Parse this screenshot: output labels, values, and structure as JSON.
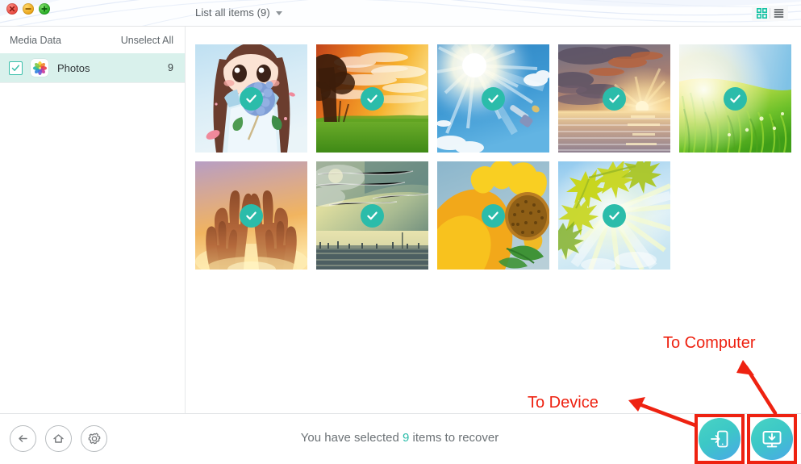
{
  "window": {
    "traffic_lights": [
      {
        "name": "close",
        "color": "#e8453c",
        "glyph": "x"
      },
      {
        "name": "minimize",
        "color": "#e9a010",
        "glyph": "minus"
      },
      {
        "name": "zoom",
        "color": "#1fa81f",
        "glyph": "plus"
      }
    ]
  },
  "header": {
    "list_all_label": "List all items (9)",
    "dropdown_icon": "chevron-down-icon",
    "view_grid_icon": "grid-view-icon",
    "view_list_icon": "list-view-icon",
    "view_active": "grid",
    "accent_color": "#2bbcaa"
  },
  "sidebar": {
    "title": "Media Data",
    "unselect_all_label": "Unselect All",
    "categories": [
      {
        "label": "Photos",
        "count": "9",
        "icon": "photos-app-icon",
        "checked": true,
        "selected": true
      }
    ]
  },
  "content": {
    "thumbnails": [
      {
        "name": "anime-girl-with-hydrangea",
        "selected": true
      },
      {
        "name": "autumn-sunset-field",
        "selected": true
      },
      {
        "name": "sunburst-blue-sky",
        "selected": true
      },
      {
        "name": "sunset-over-water",
        "selected": true
      },
      {
        "name": "green-grass-sunlight",
        "selected": true
      },
      {
        "name": "hands-raised-sunset",
        "selected": true
      },
      {
        "name": "hazy-beach-horizon",
        "selected": true
      },
      {
        "name": "sunflower-closeup",
        "selected": true
      },
      {
        "name": "maple-leaves-sunrays",
        "selected": true
      }
    ],
    "check_badge_color": "#2bbcaa"
  },
  "bottom": {
    "back_icon": "back-arrow-icon",
    "home_icon": "home-icon",
    "settings_icon": "gear-icon",
    "status_prefix": "You have selected",
    "status_count": "9",
    "status_suffix": "items to recover",
    "recover_to_device_icon": "phone-import-icon",
    "recover_to_computer_icon": "computer-download-icon"
  },
  "annotations": {
    "to_computer_label": "To Computer",
    "to_device_label": "To Device",
    "highlight_color": "#ee2211"
  }
}
